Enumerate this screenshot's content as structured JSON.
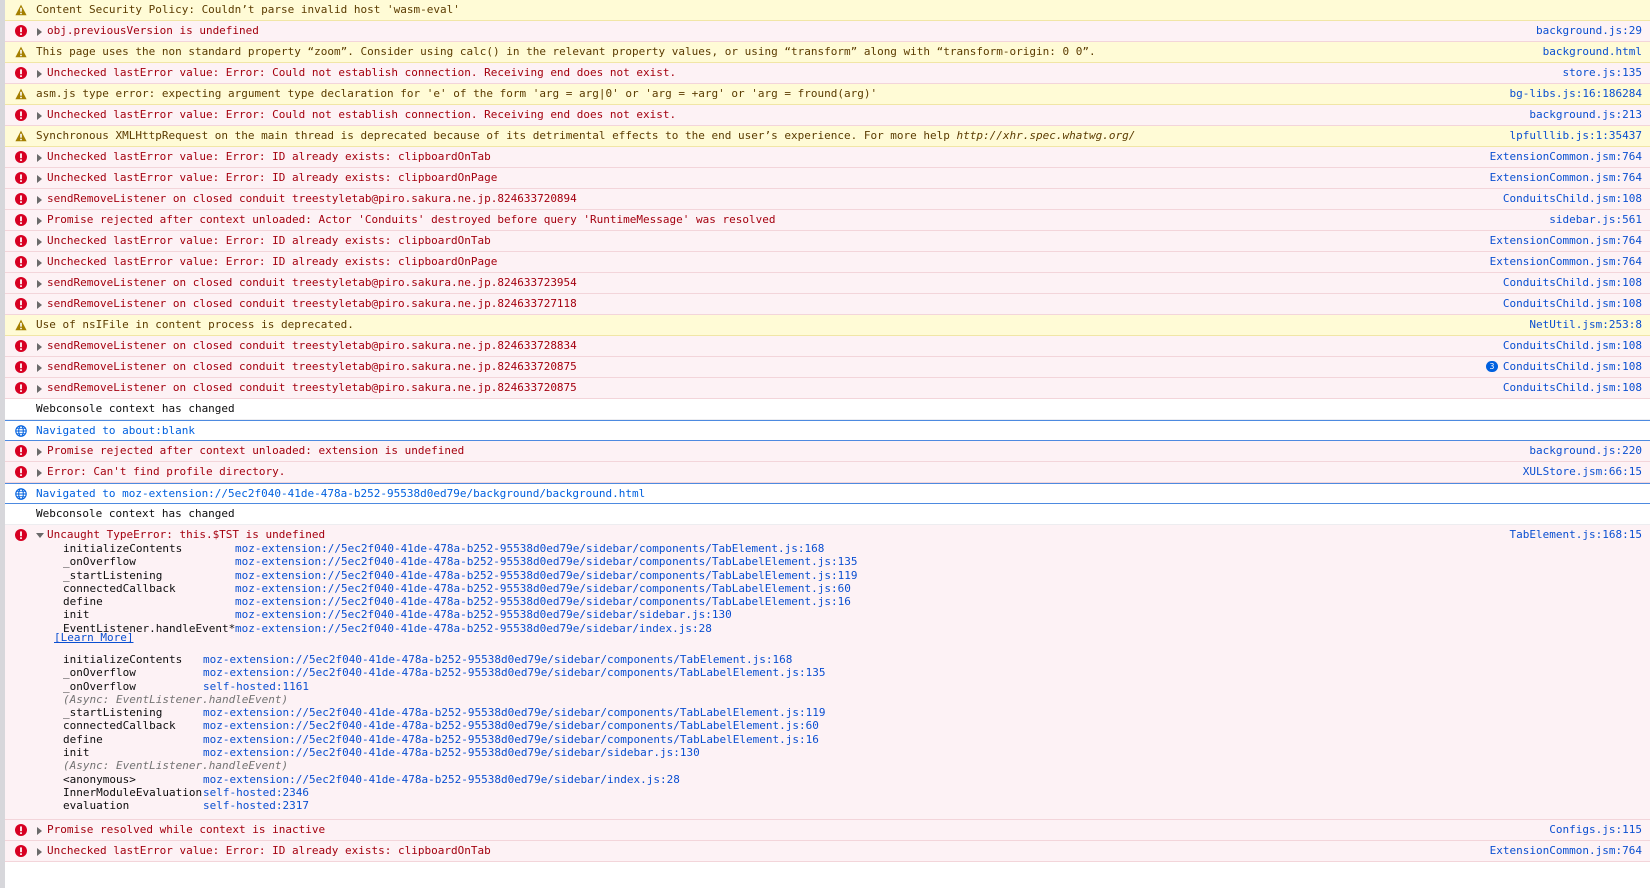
{
  "colors": {
    "error_bg": "#fdf2f5",
    "error_text": "#a4000f",
    "warn_bg": "#fffbd6",
    "link": "#0a4fd1",
    "nav": "#0060df"
  },
  "icons": {
    "error": "error-circle-icon",
    "warning": "warning-triangle-icon",
    "navigation": "globe-icon"
  },
  "messages": [
    {
      "type": "warn",
      "expandable": false,
      "text": "Content Security Policy: Couldn’t parse invalid host 'wasm-eval'",
      "location": ""
    },
    {
      "type": "error",
      "expandable": true,
      "text": "obj.previousVersion is undefined",
      "location": "background.js:29"
    },
    {
      "type": "warn",
      "expandable": false,
      "text": "This page uses the non standard property “zoom”. Consider using calc() in the relevant property values, or using “transform” along with “transform-origin: 0 0”.",
      "location": "background.html"
    },
    {
      "type": "error",
      "expandable": true,
      "text": "Unchecked lastError value: Error: Could not establish connection. Receiving end does not exist.",
      "location": "store.js:135"
    },
    {
      "type": "warn",
      "expandable": false,
      "text": "asm.js type error: expecting argument type declaration for 'e' of the form 'arg = arg|0' or 'arg = +arg' or 'arg = fround(arg)'",
      "location": "bg-libs.js:16:186284"
    },
    {
      "type": "error",
      "expandable": true,
      "text": "Unchecked lastError value: Error: Could not establish connection. Receiving end does not exist.",
      "location": "background.js:213"
    },
    {
      "type": "warn",
      "expandable": false,
      "text": "Synchronous XMLHttpRequest on the main thread is deprecated because of its detrimental effects to the end user’s experience. For more help ",
      "link_text": "http://xhr.spec.whatwg.org/",
      "location": "lpfulllib.js:1:35437"
    },
    {
      "type": "error",
      "expandable": true,
      "text": "Unchecked lastError value: Error: ID already exists: clipboardOnTab",
      "location": "ExtensionCommon.jsm:764"
    },
    {
      "type": "error",
      "expandable": true,
      "text": "Unchecked lastError value: Error: ID already exists: clipboardOnPage",
      "location": "ExtensionCommon.jsm:764"
    },
    {
      "type": "error",
      "expandable": true,
      "text": "sendRemoveListener on closed conduit treestyletab@piro.sakura.ne.jp.824633720894",
      "location": "ConduitsChild.jsm:108"
    },
    {
      "type": "error",
      "expandable": true,
      "text": "Promise rejected after context unloaded: Actor 'Conduits' destroyed before query 'RuntimeMessage' was resolved",
      "location": "sidebar.js:561"
    },
    {
      "type": "error",
      "expandable": true,
      "text": "Unchecked lastError value: Error: ID already exists: clipboardOnTab",
      "location": "ExtensionCommon.jsm:764"
    },
    {
      "type": "error",
      "expandable": true,
      "text": "Unchecked lastError value: Error: ID already exists: clipboardOnPage",
      "location": "ExtensionCommon.jsm:764"
    },
    {
      "type": "error",
      "expandable": true,
      "text": "sendRemoveListener on closed conduit treestyletab@piro.sakura.ne.jp.824633723954",
      "location": "ConduitsChild.jsm:108"
    },
    {
      "type": "error",
      "expandable": true,
      "text": "sendRemoveListener on closed conduit treestyletab@piro.sakura.ne.jp.824633727118",
      "location": "ConduitsChild.jsm:108"
    },
    {
      "type": "warn",
      "expandable": false,
      "text": "Use of nsIFile in content process is deprecated.",
      "location": "NetUtil.jsm:253:8"
    },
    {
      "type": "error",
      "expandable": true,
      "text": "sendRemoveListener on closed conduit treestyletab@piro.sakura.ne.jp.824633728834",
      "location": "ConduitsChild.jsm:108"
    },
    {
      "type": "error",
      "expandable": true,
      "text": "sendRemoveListener on closed conduit treestyletab@piro.sakura.ne.jp.824633720875",
      "location": "ConduitsChild.jsm:108",
      "badge": "3"
    },
    {
      "type": "error",
      "expandable": true,
      "text": "sendRemoveListener on closed conduit treestyletab@piro.sakura.ne.jp.824633720875",
      "location": "ConduitsChild.jsm:108"
    },
    {
      "type": "log",
      "expandable": false,
      "text": "Webconsole context has changed",
      "location": ""
    },
    {
      "type": "nav",
      "expandable": false,
      "text": "Navigated to about:blank",
      "location": ""
    },
    {
      "type": "error",
      "expandable": true,
      "text": "Promise rejected after context unloaded: extension is undefined",
      "location": "background.js:220"
    },
    {
      "type": "error",
      "expandable": true,
      "text": "Error: Can't find profile directory.",
      "location": "XULStore.jsm:66:15"
    },
    {
      "type": "nav",
      "expandable": false,
      "text": "Navigated to moz-extension://5ec2f040-41de-478a-b252-95538d0ed79e/background/background.html",
      "location": ""
    },
    {
      "type": "log",
      "expandable": false,
      "text": "Webconsole context has changed",
      "location": ""
    }
  ],
  "expanded_error": {
    "text": "Uncaught TypeError: this.$TST is undefined",
    "location": "TabElement.js:168:15",
    "stack1": [
      {
        "fn": "initializeContents",
        "src": "moz-extension://5ec2f040-41de-478a-b252-95538d0ed79e/sidebar/components/TabElement.js:168"
      },
      {
        "fn": "_onOverflow",
        "src": "moz-extension://5ec2f040-41de-478a-b252-95538d0ed79e/sidebar/components/TabLabelElement.js:135"
      },
      {
        "fn": "_startListening",
        "src": "moz-extension://5ec2f040-41de-478a-b252-95538d0ed79e/sidebar/components/TabLabelElement.js:119"
      },
      {
        "fn": "connectedCallback",
        "src": "moz-extension://5ec2f040-41de-478a-b252-95538d0ed79e/sidebar/components/TabLabelElement.js:60"
      },
      {
        "fn": "define",
        "src": "moz-extension://5ec2f040-41de-478a-b252-95538d0ed79e/sidebar/components/TabLabelElement.js:16"
      },
      {
        "fn": "init",
        "src": "moz-extension://5ec2f040-41de-478a-b252-95538d0ed79e/sidebar/sidebar.js:130"
      },
      {
        "fn": "EventListener.handleEvent*",
        "src": "moz-extension://5ec2f040-41de-478a-b252-95538d0ed79e/sidebar/index.js:28"
      }
    ],
    "learn_more": "[Learn More]",
    "stack2": [
      {
        "fn": "initializeContents",
        "src": "moz-extension://5ec2f040-41de-478a-b252-95538d0ed79e/sidebar/components/TabElement.js:168"
      },
      {
        "fn": "_onOverflow",
        "src": "moz-extension://5ec2f040-41de-478a-b252-95538d0ed79e/sidebar/components/TabLabelElement.js:135"
      },
      {
        "fn": "_onOverflow",
        "src": "self-hosted:1161"
      },
      {
        "async": "(Async: EventListener.handleEvent)"
      },
      {
        "fn": "_startListening",
        "src": "moz-extension://5ec2f040-41de-478a-b252-95538d0ed79e/sidebar/components/TabLabelElement.js:119"
      },
      {
        "fn": "connectedCallback",
        "src": "moz-extension://5ec2f040-41de-478a-b252-95538d0ed79e/sidebar/components/TabLabelElement.js:60"
      },
      {
        "fn": "define",
        "src": "moz-extension://5ec2f040-41de-478a-b252-95538d0ed79e/sidebar/components/TabLabelElement.js:16"
      },
      {
        "fn": "init",
        "src": "moz-extension://5ec2f040-41de-478a-b252-95538d0ed79e/sidebar/sidebar.js:130"
      },
      {
        "async": "(Async: EventListener.handleEvent)"
      },
      {
        "fn": "<anonymous>",
        "src": "moz-extension://5ec2f040-41de-478a-b252-95538d0ed79e/sidebar/index.js:28"
      },
      {
        "fn": "InnerModuleEvaluation",
        "src": "self-hosted:2346"
      },
      {
        "fn": "evaluation",
        "src": "self-hosted:2317"
      }
    ]
  },
  "trailing_messages": [
    {
      "type": "error",
      "expandable": true,
      "text": "Promise resolved while context is inactive",
      "location": "Configs.js:115"
    },
    {
      "type": "error",
      "expandable": true,
      "text": "Unchecked lastError value: Error: ID already exists: clipboardOnTab",
      "location": "ExtensionCommon.jsm:764"
    }
  ]
}
